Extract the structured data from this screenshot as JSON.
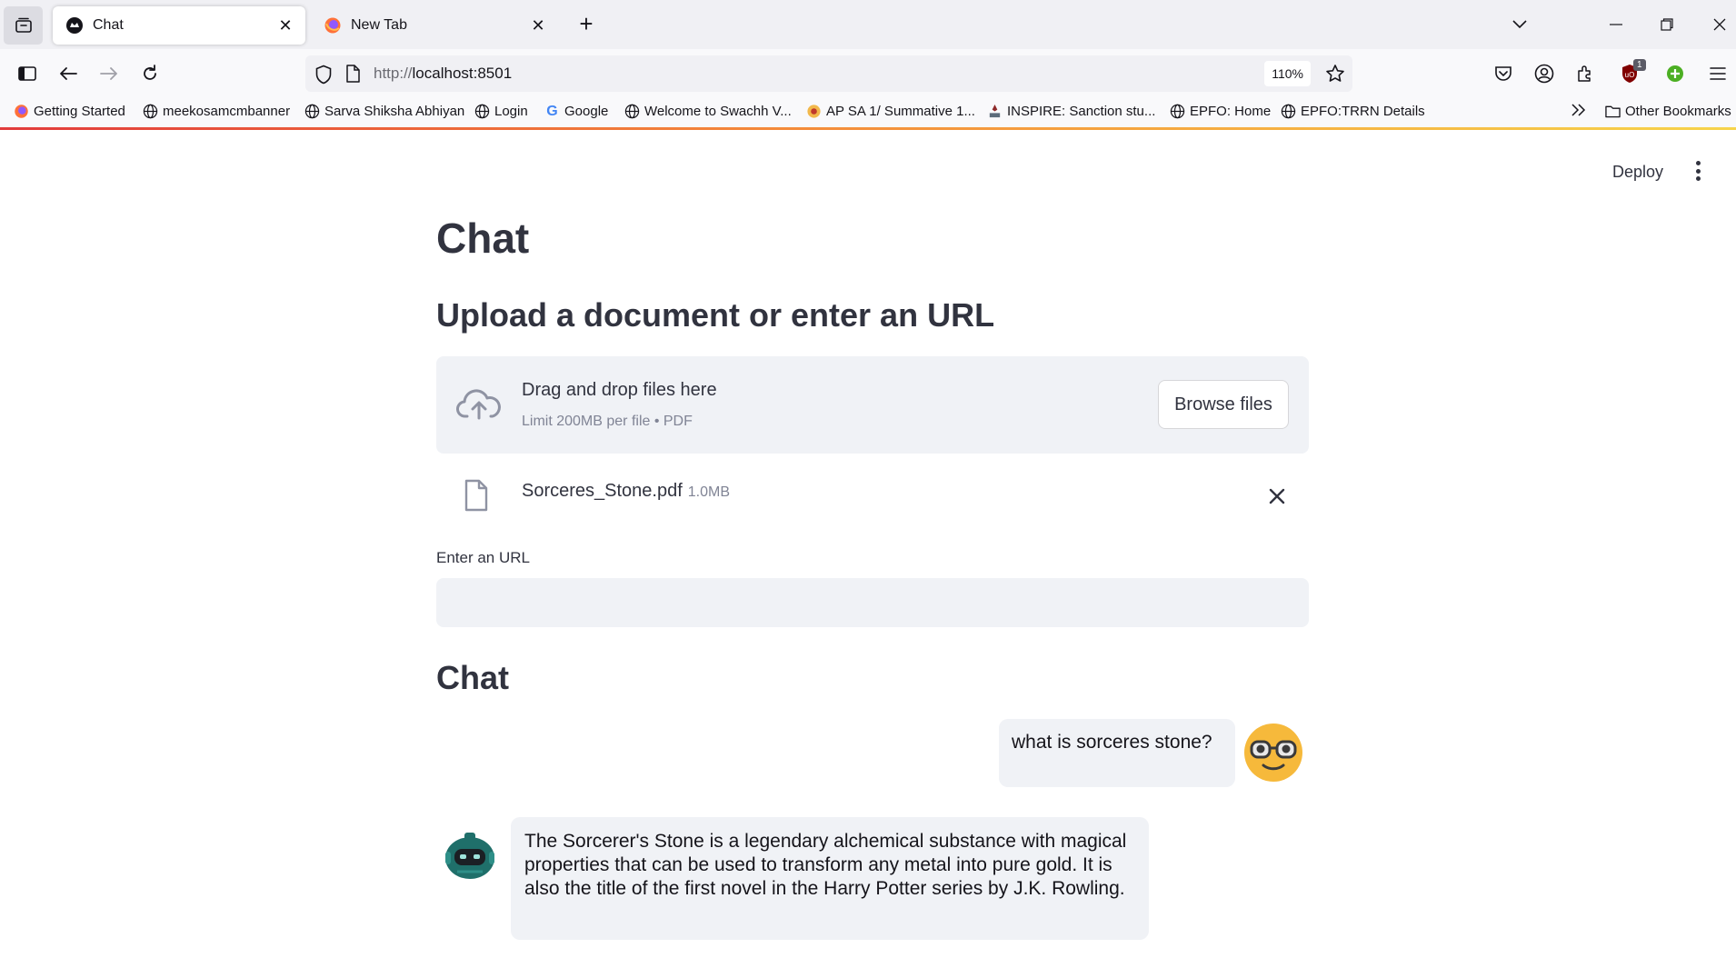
{
  "browser": {
    "tabs": [
      {
        "title": "Chat",
        "active": true
      },
      {
        "title": "New Tab",
        "active": false
      }
    ],
    "url_prefix": "http://",
    "url_host": "localhost:8501",
    "zoom": "110%",
    "bookmarks": [
      "Getting Started",
      "meekosamcmbanner",
      "Sarva Shiksha Abhiyan",
      "Login",
      "Google",
      "Welcome to Swachh V...",
      "AP SA 1/ Summative 1...",
      "INSPIRE: Sanction stu...",
      "EPFO: Home",
      "EPFO:TRRN Details"
    ],
    "other_bookmarks": "Other Bookmarks",
    "extension_badge": "1"
  },
  "app": {
    "deploy_label": "Deploy",
    "title": "Chat",
    "upload_heading": "Upload a document or enter an URL",
    "dropzone": {
      "main_text": "Drag and drop files here",
      "sub_text": "Limit 200MB per file • PDF",
      "browse_label": "Browse files"
    },
    "uploaded_file": {
      "name": "Sorceres_Stone.pdf",
      "size": "1.0MB"
    },
    "url_label": "Enter an URL",
    "url_value": "",
    "chat_heading": "Chat",
    "messages": [
      {
        "role": "user",
        "text": "what is sorceres stone?"
      },
      {
        "role": "assistant",
        "text": "The Sorcerer's Stone is a legendary alchemical substance with magical properties that can be used to transform any metal into pure gold. It is also the title of the first novel in the Harry Potter series by J.K. Rowling."
      }
    ]
  },
  "colors": {
    "text": "#31333f",
    "muted": "#808495",
    "surface": "#f0f2f6",
    "user_avatar": "#f6b93b",
    "bot_avatar": "#1f6f6a"
  },
  "icons": {
    "tab_list": "tab-list-icon",
    "sidebar": "sidebar-icon",
    "back": "back-arrow-icon",
    "forward": "forward-arrow-icon",
    "reload": "reload-icon",
    "shield": "shield-icon",
    "page": "page-icon",
    "bookmark_star": "star-icon",
    "upload": "cloud-upload-icon",
    "file": "file-icon",
    "close": "close-icon"
  }
}
